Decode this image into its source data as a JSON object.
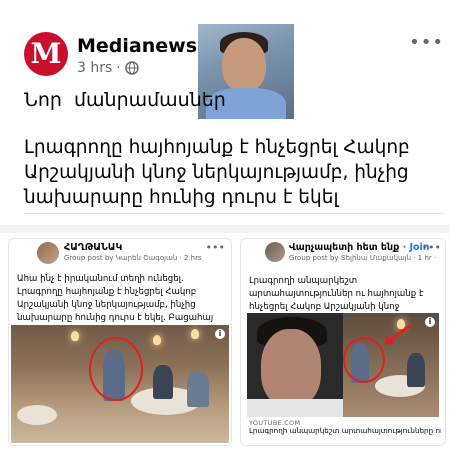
{
  "main_post": {
    "logo_letter": "M",
    "page_name": "Medianews",
    "time": "3 hrs",
    "dot": "·",
    "more": "•••",
    "headline_short": "Նոր  մանրամասներ",
    "headline_long": "Լրագրողը հայհոյանք է հնչեցրել Հակոբ Արշակյանի կնոջ ներկայությամբ, ինչից նախարարը հունից դուրս է եկել"
  },
  "left_card": {
    "group_name": "ՀԱՂԹԱՆԱԿ",
    "meta": "Group post by Կարեն Շագօյան · 2 hrs",
    "more": "•••",
    "text": "Ահա ինչ է իրականում տեղի ունեցել. Լրագրողը հայհոյանք է հնչեցրել Հակոբ Արշակյանի կնոջ ներկայությամբ, ինչից նախարարը հունից դուրս է եկել. Բացահայ ամբողջական տեսանյութ",
    "info": "i"
  },
  "right_card": {
    "group_name": "Վարչապետի հետ ենք",
    "join": "· Join",
    "meta": "Group post by Տելինա Մաքակայն · 1 hr ·",
    "more": "•••",
    "text": "Լրագրողի անպարկեշտ արտահայտություններ ու հայհոյանք է հնչեցրել Հակոբ Արշակյանի կնոջ ներկայությամբ...",
    "info": "i",
    "link_url": "YOUTUBE.COM",
    "link_title": "Լրագրողի անպարկեշտ արտահայտությունները ու հայհոյանք է հնչեց..."
  },
  "colors": {
    "brand_red": "#c8102e",
    "link_blue": "#1877f2",
    "annotation_red": "#e02020"
  },
  "icons": [
    "globe-icon",
    "more-options-icon",
    "info-icon",
    "arrow-icon"
  ]
}
